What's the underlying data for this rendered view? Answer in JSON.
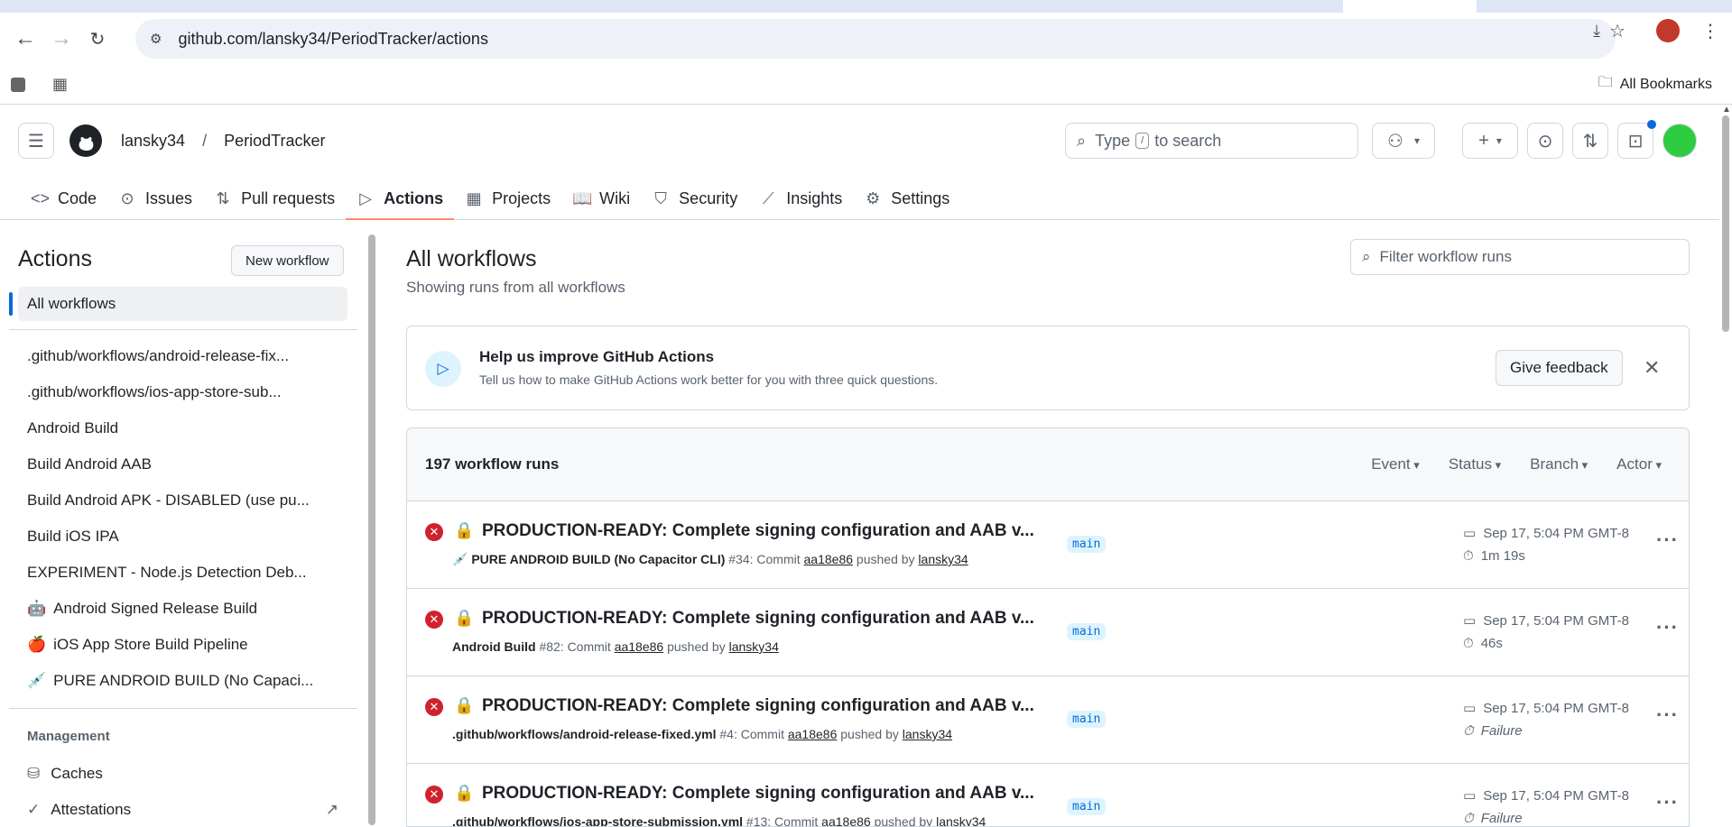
{
  "browser": {
    "url": "github.com/lansky34/PeriodTracker/actions",
    "bookmarks_label": "All Bookmarks"
  },
  "header": {
    "owner": "lansky34",
    "separator": "/",
    "repo": "PeriodTracker",
    "search_prefix": "Type",
    "search_key": "/",
    "search_suffix": "to search"
  },
  "tabs": [
    {
      "label": "Code",
      "icon": "code-icon"
    },
    {
      "label": "Issues",
      "icon": "issues-icon"
    },
    {
      "label": "Pull requests",
      "icon": "pull-request-icon"
    },
    {
      "label": "Actions",
      "icon": "play-icon"
    },
    {
      "label": "Projects",
      "icon": "table-icon"
    },
    {
      "label": "Wiki",
      "icon": "book-icon"
    },
    {
      "label": "Security",
      "icon": "shield-icon"
    },
    {
      "label": "Insights",
      "icon": "graph-icon"
    },
    {
      "label": "Settings",
      "icon": "gear-icon"
    }
  ],
  "sidebar": {
    "title": "Actions",
    "new_workflow": "New workflow",
    "all_workflows": "All workflows",
    "workflows": [
      {
        "label": ".github/workflows/android-release-fix...",
        "emoji": ""
      },
      {
        "label": ".github/workflows/ios-app-store-sub...",
        "emoji": ""
      },
      {
        "label": "Android Build",
        "emoji": ""
      },
      {
        "label": "Build Android AAB",
        "emoji": ""
      },
      {
        "label": "Build Android APK - DISABLED (use pu...",
        "emoji": ""
      },
      {
        "label": "Build iOS IPA",
        "emoji": ""
      },
      {
        "label": "EXPERIMENT - Node.js Detection Deb...",
        "emoji": ""
      },
      {
        "label": "Android Signed Release Build",
        "emoji": "🤖"
      },
      {
        "label": "iOS App Store Build Pipeline",
        "emoji": "🍎"
      },
      {
        "label": "PURE ANDROID BUILD (No Capaci...",
        "emoji": "💉"
      }
    ],
    "management_label": "Management",
    "caches": "Caches",
    "attestations": "Attestations"
  },
  "main": {
    "title": "All workflows",
    "subtitle": "Showing runs from all workflows",
    "filter_placeholder": "Filter workflow runs",
    "banner": {
      "title": "Help us improve GitHub Actions",
      "desc": "Tell us how to make GitHub Actions work better for you with three quick questions.",
      "button": "Give feedback"
    },
    "runs_count": "197 workflow runs",
    "filters": [
      "Event",
      "Status",
      "Branch",
      "Actor"
    ],
    "runs": [
      {
        "title": "PRODUCTION-READY: Complete signing configuration and AAB v...",
        "emoji": "💉",
        "workflow": "PURE ANDROID BUILD (No Capacitor CLI)",
        "number": "#34",
        "commit_prefix": ": Commit",
        "commit": "aa18e86",
        "pushed_by": "pushed by",
        "user": "lansky34",
        "branch": "main",
        "date": "Sep 17, 5:04 PM GMT-8",
        "duration": "1m 19s",
        "failed": false
      },
      {
        "title": "PRODUCTION-READY: Complete signing configuration and AAB v...",
        "emoji": "",
        "workflow": "Android Build",
        "number": "#82",
        "commit_prefix": ": Commit",
        "commit": "aa18e86",
        "pushed_by": "pushed by",
        "user": "lansky34",
        "branch": "main",
        "date": "Sep 17, 5:04 PM GMT-8",
        "duration": "46s",
        "failed": false
      },
      {
        "title": "PRODUCTION-READY: Complete signing configuration and AAB v...",
        "emoji": "",
        "workflow": ".github/workflows/android-release-fixed.yml",
        "number": "#4",
        "commit_prefix": ": Commit",
        "commit": "aa18e86",
        "pushed_by": "pushed by",
        "user": "lansky34",
        "branch": "main",
        "date": "Sep 17, 5:04 PM GMT-8",
        "duration": "Failure",
        "failed": true
      },
      {
        "title": "PRODUCTION-READY: Complete signing configuration and AAB v...",
        "emoji": "",
        "workflow": ".github/workflows/ios-app-store-submission.yml",
        "number": "#13",
        "commit_prefix": ": Commit",
        "commit": "aa18e86",
        "pushed_by": "pushed by",
        "user": "lansky34",
        "branch": "main",
        "date": "Sep 17, 5:04 PM GMT-8",
        "duration": "Failure",
        "failed": true
      }
    ]
  }
}
